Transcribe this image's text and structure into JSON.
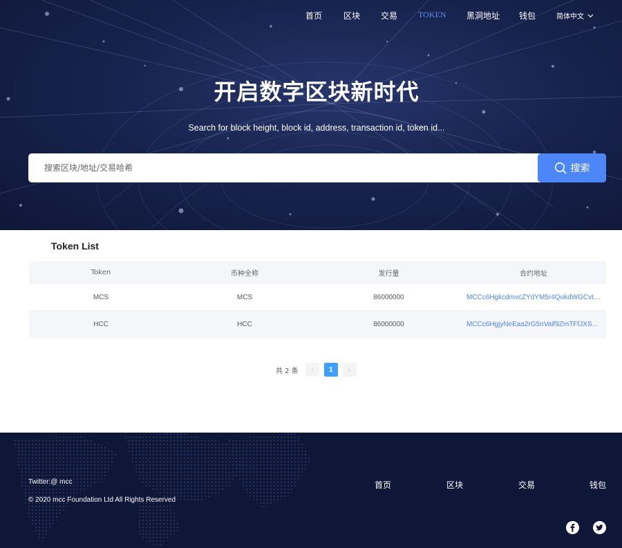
{
  "nav": {
    "items": [
      "首页",
      "区块",
      "交易",
      "TOKEN",
      "黑洞地址",
      "钱包"
    ],
    "language": "简体中文"
  },
  "hero": {
    "title": "开启数字区块新时代",
    "subtitle": "Search for block height, block id, address, transaction id, token id...",
    "search_placeholder": "搜索区块/地址/交易哈希",
    "search_button": "搜索"
  },
  "token_list": {
    "title": "Token List",
    "columns": [
      "Token",
      "币种全称",
      "发行量",
      "合约地址"
    ],
    "rows": [
      {
        "token": "MCS",
        "name": "MCS",
        "supply": "86000000",
        "contract": "MCCc6HgkcdmvcZYdYM5r4QokdWGCvtn..."
      },
      {
        "token": "HCC",
        "name": "HCC",
        "supply": "86000000",
        "contract": "MCCc6HgjyNeEaa2rG5nVaif9ZmTFfJXSph..."
      }
    ],
    "pagination": {
      "total": "共 2 条",
      "current_page": "1",
      "prev": "‹",
      "next": "›"
    }
  },
  "footer": {
    "twitter": "Twitter:@ mcc",
    "copyright": "© 2020 mcc Foundation Ltd All Rights Reserved",
    "links": [
      "首页",
      "区块",
      "交易",
      "钱包"
    ],
    "social_icons": [
      "facebook-icon",
      "twitter-icon"
    ]
  },
  "colors": {
    "hero_bg": "#18244f",
    "accent": "#4d86f7",
    "active_nav": "#5d8cf2",
    "pager_active": "#409eff",
    "footer_bg": "#0f1738"
  }
}
